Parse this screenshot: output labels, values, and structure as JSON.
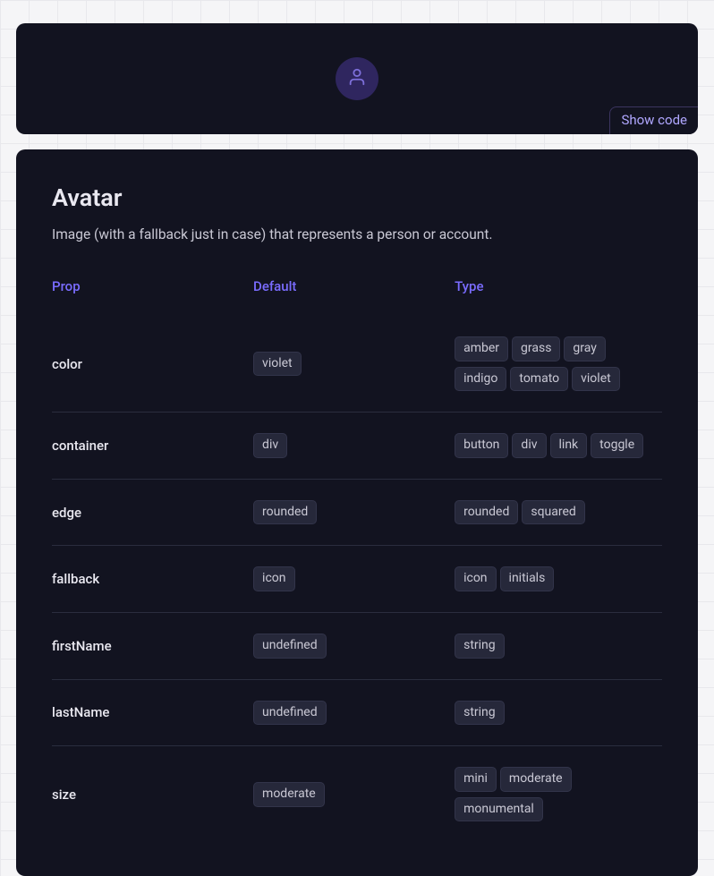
{
  "demo": {
    "show_code_label": "Show code"
  },
  "doc": {
    "title": "Avatar",
    "description": "Image (with a fallback just in case) that represents a person or account."
  },
  "headers": {
    "prop": "Prop",
    "default": "Default",
    "type": "Type"
  },
  "props": [
    {
      "name": "color",
      "default": "violet",
      "types": [
        "amber",
        "grass",
        "gray",
        "indigo",
        "tomato",
        "violet"
      ]
    },
    {
      "name": "container",
      "default": "div",
      "types": [
        "button",
        "div",
        "link",
        "toggle"
      ]
    },
    {
      "name": "edge",
      "default": "rounded",
      "types": [
        "rounded",
        "squared"
      ]
    },
    {
      "name": "fallback",
      "default": "icon",
      "types": [
        "icon",
        "initials"
      ]
    },
    {
      "name": "firstName",
      "default": "undefined",
      "types": [
        "string"
      ]
    },
    {
      "name": "lastName",
      "default": "undefined",
      "types": [
        "string"
      ]
    },
    {
      "name": "size",
      "default": "moderate",
      "types": [
        "mini",
        "moderate",
        "monumental"
      ]
    }
  ],
  "colors": {
    "accent": "#7a6cff",
    "icon_stroke": "#7d6fd9"
  }
}
